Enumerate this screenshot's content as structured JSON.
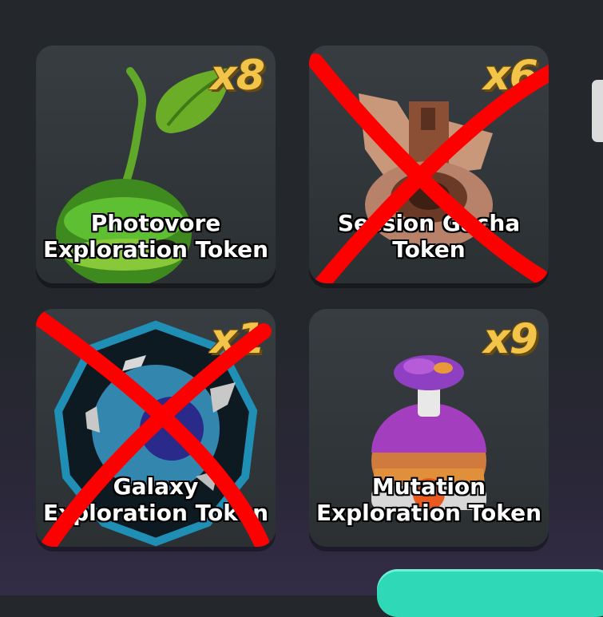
{
  "inventory": {
    "items": [
      {
        "name_line1": "Photovore",
        "name_line2": "Exploration Token",
        "count": "x8",
        "crossed_out": false
      },
      {
        "name_line1": "Session Gacha",
        "name_line2": "Token",
        "count": "x6",
        "crossed_out": true
      },
      {
        "name_line1": "Galaxy",
        "name_line2": "Exploration Token",
        "count": "x1",
        "crossed_out": true
      },
      {
        "name_line1": "Mutation",
        "name_line2": "Exploration Token",
        "count": "x9",
        "crossed_out": false
      }
    ]
  },
  "colors": {
    "count_text": "#f2c54a",
    "cross_mark": "#ff0000",
    "accent_button": "#2fd9b8"
  },
  "icons": [
    "sprout-icon",
    "gacha-capsule-icon",
    "galaxy-planet-icon",
    "mushroom-potion-icon"
  ]
}
